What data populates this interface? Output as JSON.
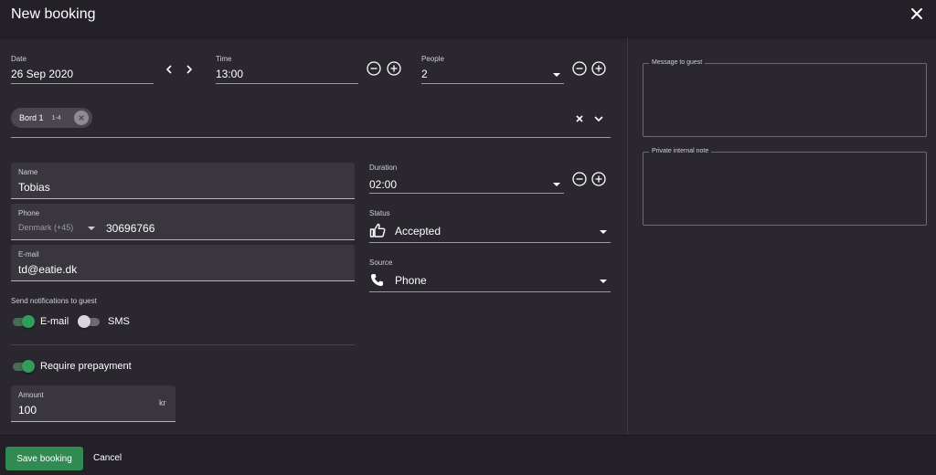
{
  "header": {
    "title": "New booking"
  },
  "date": {
    "label": "Date",
    "value": "26 Sep 2020"
  },
  "time": {
    "label": "Time",
    "value": "13:00"
  },
  "people": {
    "label": "People",
    "value": "2"
  },
  "table_chip": {
    "label": "Bord 1",
    "capacity": "1-4"
  },
  "name": {
    "label": "Name",
    "value": "Tobias"
  },
  "phone": {
    "label": "Phone",
    "country": "Denmark (+45)",
    "value": "30696766"
  },
  "email": {
    "label": "E-mail",
    "value": "td@eatie.dk"
  },
  "notifications": {
    "label": "Send notifications to guest",
    "email_label": "E-mail",
    "email_on": true,
    "sms_label": "SMS",
    "sms_on": false
  },
  "prepayment": {
    "label": "Require prepayment",
    "on": true
  },
  "amount": {
    "label": "Amount",
    "value": "100",
    "suffix": "kr"
  },
  "duration": {
    "label": "Duration",
    "value": "02:00"
  },
  "status": {
    "label": "Status",
    "value": "Accepted",
    "icon": "thumbs-up-icon"
  },
  "source": {
    "label": "Source",
    "value": "Phone",
    "icon": "phone-icon"
  },
  "message_to_guest": {
    "label": "Message to guest",
    "value": ""
  },
  "private_note": {
    "label": "Private internal note",
    "value": ""
  },
  "footer": {
    "save_label": "Save booking",
    "cancel_label": "Cancel"
  },
  "colors": {
    "accent": "#2f8b51",
    "background": "#2a282e",
    "toggle_on": "#2f9e5b"
  }
}
